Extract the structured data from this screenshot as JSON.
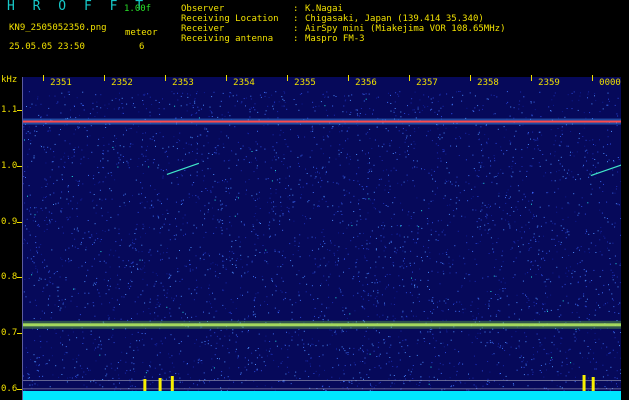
{
  "header": {
    "app_name": "H R O F F T",
    "version": "1.00f",
    "filename": "KN9_2505052350.png",
    "datetime": "25.05.05 23:50",
    "meteor_label": "meteor",
    "meteor_count": "6",
    "fields": [
      {
        "key": "Observer",
        "value": "K.Nagai"
      },
      {
        "key": "Receiving Location",
        "value": "Chigasaki, Japan (139.414 35.340)"
      },
      {
        "key": "Receiver",
        "value": "AirSpy mini (Miakejima VOR 108.65MHz)"
      },
      {
        "key": "Receiving antenna",
        "value": "Maspro FM-3"
      }
    ]
  },
  "spectrogram": {
    "y_unit": "kHz",
    "y_ticks": [
      1.1,
      1.0,
      0.9,
      0.8,
      0.7,
      0.6
    ],
    "y_range": [
      0.58,
      1.16
    ],
    "x_ticks": [
      "2351",
      "2352",
      "2353",
      "2354",
      "2355",
      "2356",
      "2357",
      "2358",
      "2359",
      "0000"
    ],
    "colors": {
      "background": "#06095a",
      "text": "#f0e000",
      "brand": "#17c9c9",
      "carrier": "#ff4a4a",
      "band": "#7ae63a",
      "baseline": "#00e6ff"
    },
    "carrier_khz": 1.08,
    "band_khz": 0.715,
    "ref_lines_khz": [
      0.615,
      0.6
    ],
    "meteor_traces": [
      {
        "x_minute": 2.9,
        "khz_start": 0.985,
        "khz_end": 1.005
      },
      {
        "x_minute": 9.85,
        "khz_start": 0.983,
        "khz_end": 1.003
      }
    ],
    "bursts": [
      {
        "x_minute": 2.35,
        "height": 0.6
      },
      {
        "x_minute": 2.6,
        "height": 0.7
      },
      {
        "x_minute": 2.8,
        "height": 0.9
      },
      {
        "x_minute": 9.55,
        "height": 1.0
      },
      {
        "x_minute": 9.7,
        "height": 0.8
      }
    ]
  }
}
